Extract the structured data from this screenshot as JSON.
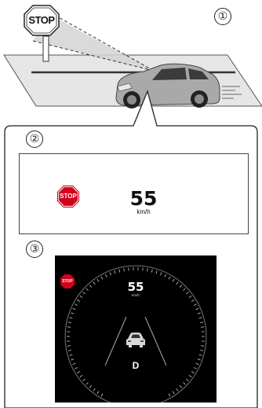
{
  "scene": {
    "step1": "①",
    "road_sign_text": "STOP"
  },
  "display_windshield": {
    "step": "②",
    "sign_text": "STOP",
    "speed": "55",
    "unit": "km/h"
  },
  "display_cluster": {
    "step": "③",
    "sign_text": "STOP",
    "speed": "55",
    "unit": "km/h",
    "gear": "D"
  },
  "colors": {
    "sign_red": "#d0021b",
    "road": "#e6e6e6",
    "callout_border": "#222222",
    "cluster_bg": "#000000"
  },
  "icons": [
    "stop-sign-icon",
    "car-icon",
    "car-rear-icon"
  ]
}
